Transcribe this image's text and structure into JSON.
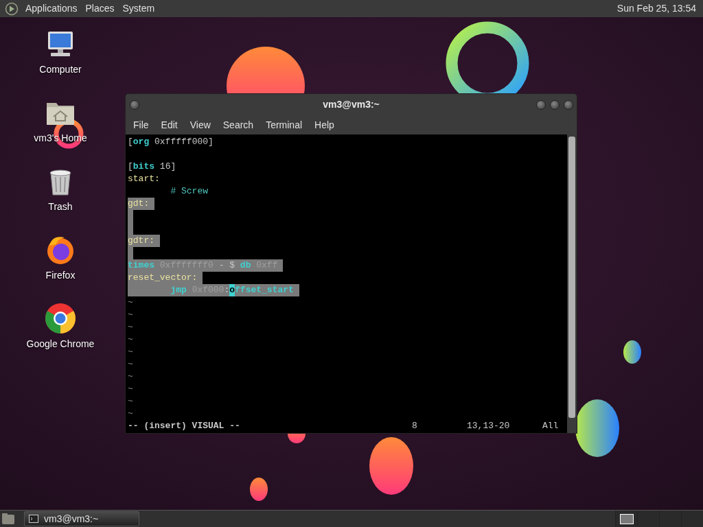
{
  "top_panel": {
    "menus": [
      "Applications",
      "Places",
      "System"
    ],
    "clock": "Sun Feb 25, 13:54"
  },
  "desktop_icons": [
    {
      "kind": "computer",
      "label": "Computer"
    },
    {
      "kind": "home",
      "label": "vm3's Home"
    },
    {
      "kind": "trash",
      "label": "Trash"
    },
    {
      "kind": "firefox",
      "label": "Firefox"
    },
    {
      "kind": "chrome",
      "label": "Google Chrome"
    }
  ],
  "window": {
    "title": "vm3@vm3:~",
    "menu": [
      "File",
      "Edit",
      "View",
      "Search",
      "Terminal",
      "Help"
    ],
    "lines": [
      {
        "selected": false,
        "segments": [
          {
            "text": "[",
            "kind": "plain"
          },
          {
            "text": "org",
            "kind": "keyword"
          },
          {
            "text": " 0xfffff000]",
            "kind": "plain"
          }
        ]
      },
      {
        "selected": false
      },
      {
        "selected": false,
        "segments": [
          {
            "text": "[",
            "kind": "plain"
          },
          {
            "text": "bits",
            "kind": "keyword"
          },
          {
            "text": " 16]",
            "kind": "plain"
          }
        ]
      },
      {
        "selected": false,
        "segments": [
          {
            "text": "start:",
            "kind": "label"
          }
        ]
      },
      {
        "selected": false,
        "segments": [
          {
            "text": "        # Screw",
            "kind": "comment"
          }
        ]
      },
      {
        "selected": true,
        "segments": [
          {
            "text": "gdt:",
            "kind": "label"
          }
        ]
      },
      {
        "selected": true
      },
      {
        "selected": true
      },
      {
        "selected": true,
        "segments": [
          {
            "text": "gdtr:",
            "kind": "label"
          }
        ]
      },
      {
        "selected": true
      },
      {
        "selected": true,
        "segments": [
          {
            "text": "times",
            "kind": "keyword"
          },
          {
            "text": " 0xfffffff0 ",
            "kind": "number"
          },
          {
            "text": "- $ ",
            "kind": "plain"
          },
          {
            "text": "db",
            "kind": "keyword"
          },
          {
            "text": " 0xff",
            "kind": "number"
          }
        ]
      },
      {
        "selected": true,
        "segments": [
          {
            "text": "reset_vector:",
            "kind": "label"
          }
        ]
      },
      {
        "selected": true,
        "segments": [
          {
            "text": "        jmp",
            "kind": "keyword"
          },
          {
            "text": " 0xf000",
            "kind": "number"
          },
          {
            "text": ":",
            "kind": "plain"
          },
          {
            "text": "o",
            "kind": "cursor"
          },
          {
            "text": "ffset_start",
            "kind": "ident"
          }
        ]
      },
      {
        "selected": false,
        "segments": [
          {
            "text": "~",
            "kind": "tilde"
          }
        ]
      },
      {
        "selected": false,
        "segments": [
          {
            "text": "~",
            "kind": "tilde"
          }
        ]
      },
      {
        "selected": false,
        "segments": [
          {
            "text": "~",
            "kind": "tilde"
          }
        ]
      },
      {
        "selected": false,
        "segments": [
          {
            "text": "~",
            "kind": "tilde"
          }
        ]
      },
      {
        "selected": false,
        "segments": [
          {
            "text": "~",
            "kind": "tilde"
          }
        ]
      },
      {
        "selected": false,
        "segments": [
          {
            "text": "~",
            "kind": "tilde"
          }
        ]
      },
      {
        "selected": false,
        "segments": [
          {
            "text": "~",
            "kind": "tilde"
          }
        ]
      },
      {
        "selected": false,
        "segments": [
          {
            "text": "~",
            "kind": "tilde"
          }
        ]
      },
      {
        "selected": false,
        "segments": [
          {
            "text": "~",
            "kind": "tilde"
          }
        ]
      },
      {
        "selected": false,
        "segments": [
          {
            "text": "~",
            "kind": "tilde"
          }
        ]
      }
    ],
    "status": {
      "mode": "-- (insert) VISUAL --",
      "selection_count": "8",
      "position": "13,13-20",
      "scroll": "All"
    }
  },
  "bottom_panel": {
    "tasks": [
      {
        "label": "vm3@vm3:~",
        "selected": true
      }
    ],
    "workspaces": [
      {
        "selected": true
      },
      {
        "selected": false
      },
      {
        "selected": false
      },
      {
        "selected": false
      }
    ]
  }
}
